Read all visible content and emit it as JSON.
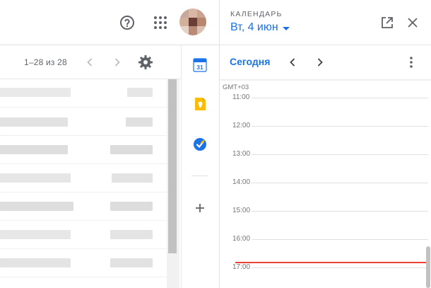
{
  "header": {
    "help_icon": "help-circle-icon",
    "apps_icon": "grid-apps-icon",
    "avatar_label": "account-avatar"
  },
  "toolbar": {
    "pager_text": "1–28 из 28"
  },
  "calendar": {
    "title": "КАЛЕНДАРЬ",
    "date": "Вт, 4 июн",
    "today_label": "Сегодня",
    "timezone": "GMT+03",
    "hours": [
      "11:00",
      "12:00",
      "13:00",
      "14:00",
      "15:00",
      "16:00",
      "17:00"
    ]
  },
  "side_apps": {
    "calendar_icon_text": "31"
  },
  "colors": {
    "accent": "#1a73e8",
    "now_line": "#ea4335",
    "keep_yellow": "#fbbc04"
  }
}
